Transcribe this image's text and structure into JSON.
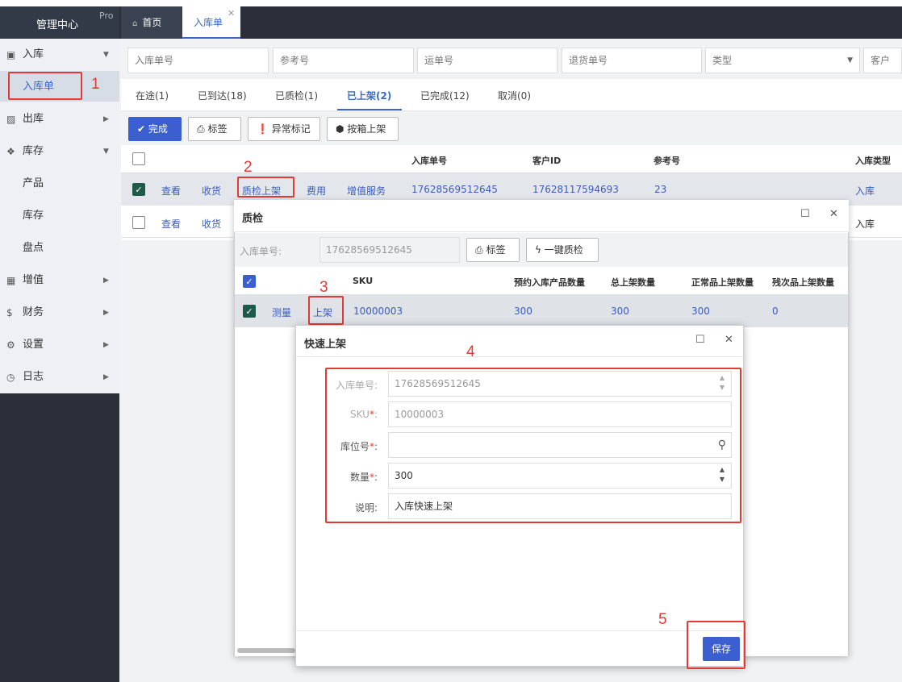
{
  "brand": {
    "name": "管理中心",
    "badge": "Pro"
  },
  "tabs": {
    "home": "首页",
    "active": "入库单"
  },
  "sidebar": {
    "items": [
      {
        "label": "入库",
        "icon": "inbox-icon"
      },
      {
        "label": "入库单"
      },
      {
        "label": "出库",
        "icon": "truck-icon"
      },
      {
        "label": "库存",
        "icon": "cubes-icon"
      },
      {
        "label": "产品"
      },
      {
        "label": "库存"
      },
      {
        "label": "盘点"
      },
      {
        "label": "增值",
        "icon": "grid-icon"
      },
      {
        "label": "财务",
        "icon": "dollar-icon"
      },
      {
        "label": "设置",
        "icon": "cogs-icon"
      },
      {
        "label": "日志",
        "icon": "clock-icon"
      }
    ]
  },
  "filters": {
    "inbound_no": "入库单号",
    "ref_no": "参考号",
    "waybill": "运单号",
    "return_no": "退货单号",
    "type": "类型",
    "customer": "客户"
  },
  "status_tabs": [
    "在途(1)",
    "已到达(18)",
    "已质检(1)",
    "已上架(2)",
    "已完成(12)",
    "取消(0)"
  ],
  "toolbar": {
    "done": "完成",
    "label": "标签",
    "exception": "异常标记",
    "box_shelve": "按箱上架"
  },
  "grid": {
    "headers": {
      "inbound_no": "入库单号",
      "customer_id": "客户ID",
      "ref_no": "参考号",
      "type": "入库类型"
    },
    "row1": {
      "view": "查看",
      "receive": "收货",
      "qc_shelve": "质检上架",
      "fee": "费用",
      "vas": "增值服务",
      "inbound_no": "17628569512645",
      "customer_id": "17628117594693",
      "ref": "23",
      "type": "入库"
    },
    "row2": {
      "view": "查看",
      "receive": "收货",
      "type": "入库"
    }
  },
  "qc_dialog": {
    "title": "质检",
    "inbound_label": "入库单号:",
    "inbound_value": "17628569512645",
    "label_btn": "标签",
    "one_key_qc": "一键质检",
    "headers": {
      "sku": "SKU",
      "expected": "预约入库产品数量",
      "total": "总上架数量",
      "normal": "正常品上架数量",
      "defect": "残次品上架数量"
    },
    "row": {
      "measure": "测量",
      "shelve": "上架",
      "sku": "10000003",
      "expected": "300",
      "total": "300",
      "normal": "300",
      "defect": "0"
    }
  },
  "quick_dialog": {
    "title": "快速上架",
    "inbound_label": "入库单号:",
    "inbound_value": "17628569512645",
    "sku_label": "SKU",
    "sku_value": "10000003",
    "location_label": "库位号",
    "location_value": "",
    "qty_label": "数量",
    "qty_value": "300",
    "note_label": "说明:",
    "note_value": "入库快速上架",
    "save": "保存"
  },
  "annotations": [
    "1",
    "2",
    "3",
    "4",
    "5"
  ]
}
